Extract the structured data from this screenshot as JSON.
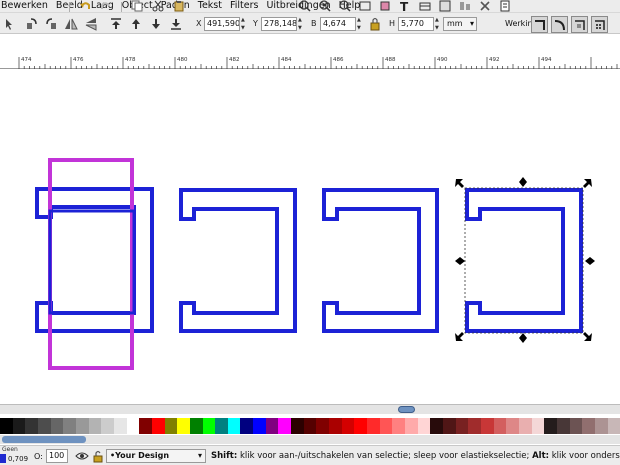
{
  "menu": [
    "Bewerken",
    "Beeld",
    "Laag",
    "Object",
    "Paden",
    "Tekst",
    "Filters",
    "Uitbreidingen",
    "Help"
  ],
  "coords": {
    "x_label": "X",
    "x_value": "491,590",
    "y_label": "Y",
    "y_value": "278,148",
    "w_label": "B",
    "w_value": "4,674",
    "h_label": "H",
    "h_value": "5,770",
    "unit": "mm"
  },
  "werking_label": "Werking:",
  "ruler_labels": [
    "474",
    "476",
    "478",
    "480",
    "482",
    "484",
    "486",
    "488",
    "490",
    "492",
    "494"
  ],
  "status": {
    "fill_label": "Geen",
    "stroke_width": "0,709",
    "opacity_label": "O:",
    "opacity_value": "100",
    "layer": "•Your Design",
    "message_bold1": "Shift:",
    "message1": " klik voor aan-/uitschakelen van selectie; sleep voor elastiekselectie; ",
    "message_bold2": "Alt:",
    "message2": " klik voor onders"
  },
  "colors": {
    "shape_stroke": "#1c22d6",
    "magenta": "#c234d8",
    "palette": [
      "#000000",
      "#1a1a1a",
      "#333333",
      "#4d4d4d",
      "#666666",
      "#808080",
      "#999999",
      "#b3b3b3",
      "#cccccc",
      "#e6e6e6",
      "#ffffff",
      "#800000",
      "#ff0000",
      "#808000",
      "#ffff00",
      "#008000",
      "#00ff00",
      "#008080",
      "#00ffff",
      "#000080",
      "#0000ff",
      "#800080",
      "#ff00ff",
      "#2b0000",
      "#550000",
      "#800000",
      "#aa0000",
      "#d40000",
      "#ff0000",
      "#ff2a2a",
      "#ff5555",
      "#ff8080",
      "#ffaaaa",
      "#ffd5d5",
      "#280b0b",
      "#501616",
      "#782121",
      "#a02c2c",
      "#c83737",
      "#d35f5f",
      "#de8787",
      "#e9afaf",
      "#f4d7d7",
      "#241c1c",
      "#483737",
      "#6c5353",
      "#916f6f",
      "#ac9393",
      "#c8b7b7"
    ]
  }
}
